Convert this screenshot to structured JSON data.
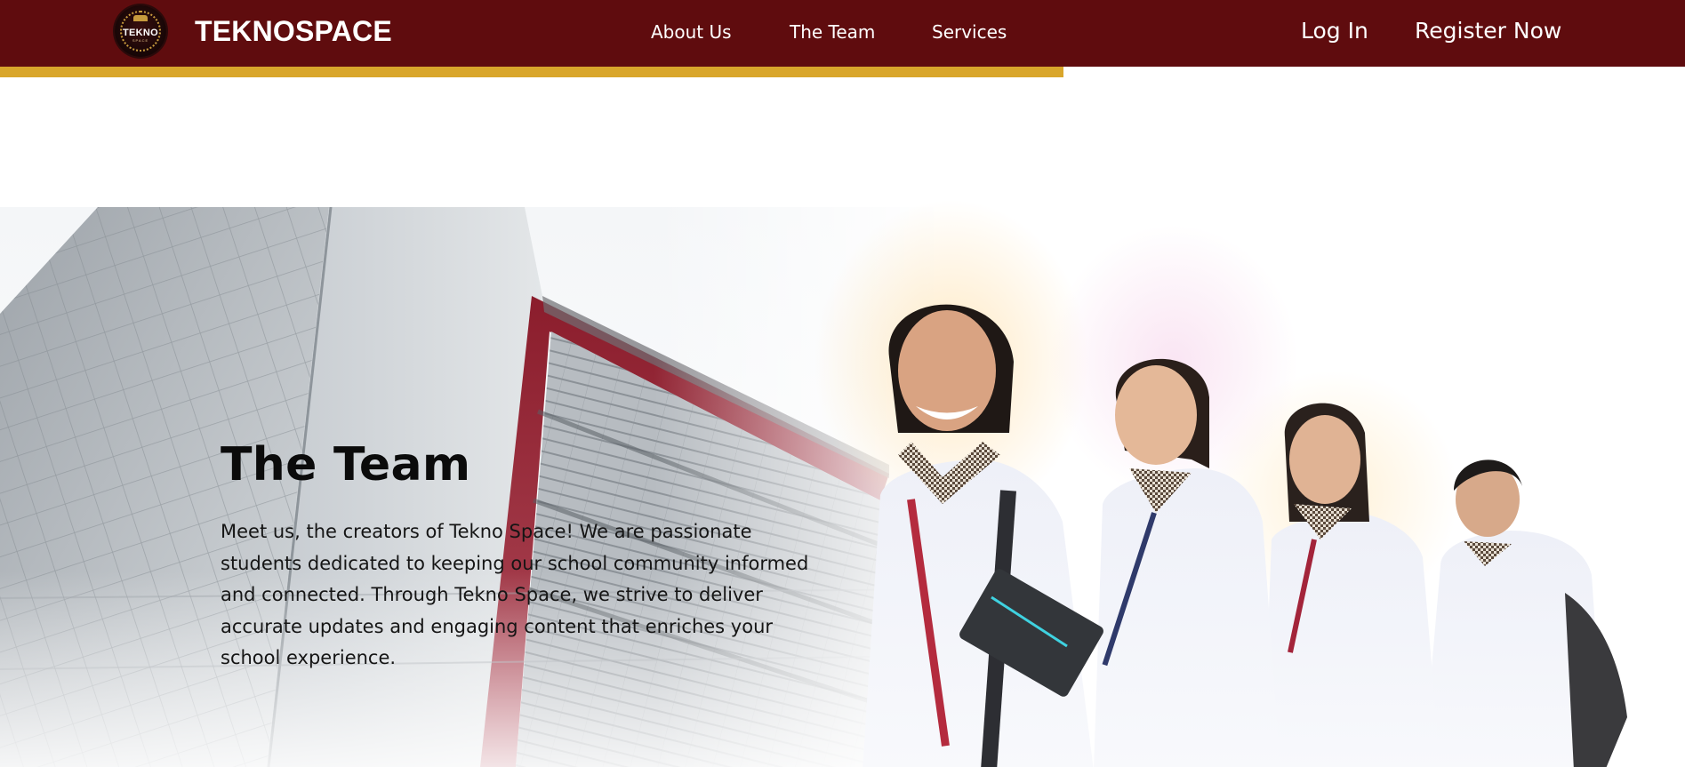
{
  "brand": {
    "logo_text": "TEKNO",
    "logo_subtext": "SPACE",
    "name": "TEKNOSPACE"
  },
  "nav": {
    "links": [
      "About Us",
      "The Team",
      "Services"
    ],
    "login": "Log In",
    "register": "Register Now"
  },
  "hero": {
    "title": "The Team",
    "description": "Meet us, the creators of Tekno Space! We are passionate students dedicated to keeping our school community informed and connected. Through Tekno Space, we strive to deliver accurate updates and engaging content that enriches your school experience."
  },
  "colors": {
    "navbar": "#5f0c0e",
    "accent": "#d9a62b",
    "text": "#151515"
  }
}
